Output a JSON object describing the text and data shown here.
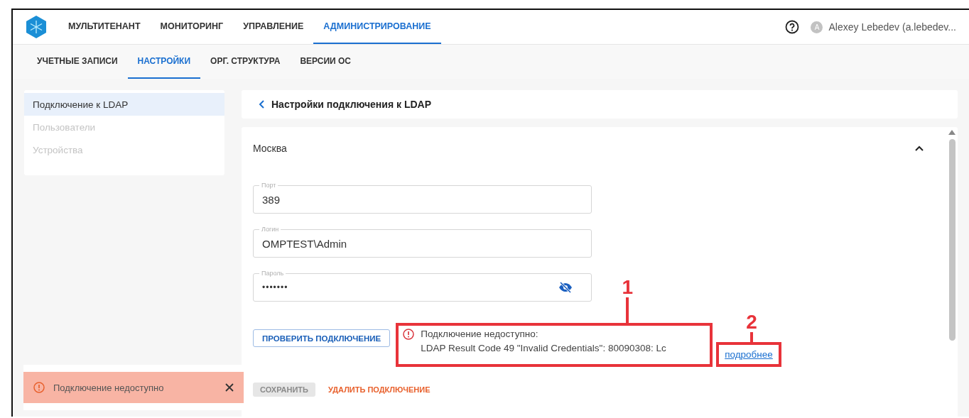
{
  "header": {
    "nav": [
      {
        "label": "МУЛЬТИТЕНАНТ",
        "selected": false
      },
      {
        "label": "МОНИТОРИНГ",
        "selected": false
      },
      {
        "label": "УПРАВЛЕНИЕ",
        "selected": false
      },
      {
        "label": "АДМИНИСТРИРОВАНИЕ",
        "selected": true
      }
    ],
    "user": {
      "initial": "A",
      "name": "Alexey Lebedev (a.lebedev..."
    }
  },
  "subtabs": [
    {
      "label": "УЧЕТНЫЕ ЗАПИСИ",
      "selected": false
    },
    {
      "label": "НАСТРОЙКИ",
      "selected": true
    },
    {
      "label": "ОРГ. СТРУКТУРА",
      "selected": false
    },
    {
      "label": "ВЕРСИИ ОС",
      "selected": false
    }
  ],
  "sidebar": {
    "items": [
      {
        "label": "Подключение к LDAP",
        "selected": true,
        "disabled": false
      },
      {
        "label": "Пользователи",
        "selected": false,
        "disabled": true
      },
      {
        "label": "Устройства",
        "selected": false,
        "disabled": true
      }
    ]
  },
  "panel": {
    "title": "Настройки подключения к LDAP",
    "section": {
      "title": "Москва",
      "expanded": true
    },
    "fields": [
      {
        "kind": "text",
        "label": "Порт",
        "value": "389"
      },
      {
        "kind": "text",
        "label": "Логин",
        "value": "OMPTEST\\Admin"
      },
      {
        "kind": "password",
        "label": "Пароль",
        "value": "•••••••"
      }
    ],
    "check_button": "ПРОВЕРИТЬ ПОДКЛЮЧЕНИЕ",
    "error": {
      "title": "Подключение недоступно:",
      "detail": "LDAP Result Code 49 \"Invalid Credentials\": 80090308: Lc",
      "link": "подробнее"
    },
    "save_button": {
      "label": "СОХРАНИТЬ",
      "disabled": true
    },
    "delete_button": "УДАЛИТЬ ПОДКЛЮЧЕНИЕ"
  },
  "toast": {
    "message": "Подключение недоступно"
  },
  "annotations": [
    {
      "number": "1"
    },
    {
      "number": "2"
    }
  ]
}
